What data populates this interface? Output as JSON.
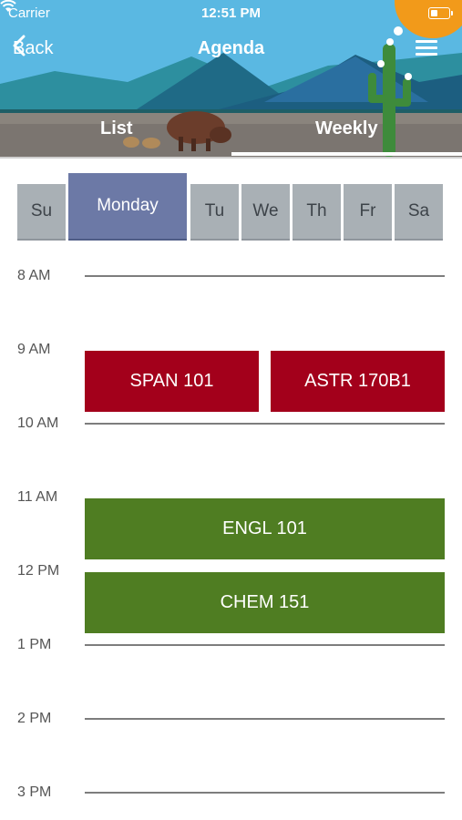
{
  "status_bar": {
    "carrier": "Carrier",
    "time": "12:51 PM"
  },
  "nav": {
    "back_label": "Back",
    "title": "Agenda"
  },
  "tabs": {
    "list": "List",
    "weekly": "Weekly",
    "selected": "Weekly"
  },
  "days": [
    "Su",
    "Monday",
    "Tu",
    "We",
    "Th",
    "Fr",
    "Sa"
  ],
  "selected_day": "Monday",
  "times": [
    "8 AM",
    "9 AM",
    "10 AM",
    "11 AM",
    "12 PM",
    "1 PM",
    "2 PM",
    "3 PM"
  ],
  "events": [
    {
      "title": "SPAN 101"
    },
    {
      "title": "ASTR 170B1"
    },
    {
      "title": "ENGL 101"
    },
    {
      "title": "CHEM 151"
    }
  ],
  "colors": {
    "header_sky": "#5ab8e2",
    "day_selected": "#6c79a6",
    "day_default": "#a9b0b5",
    "event_red": "#a3001b",
    "event_green": "#4f7d22",
    "badge_orange": "#f29a1a"
  }
}
